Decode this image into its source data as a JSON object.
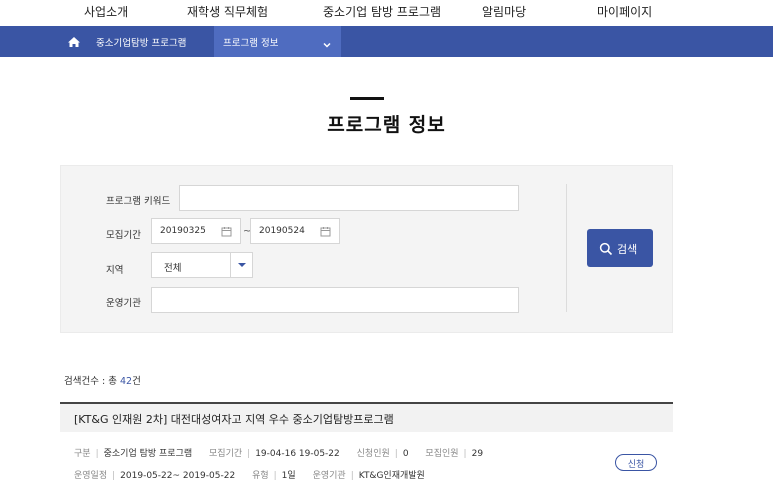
{
  "top_nav": {
    "items": [
      "사업소개",
      "재학생 직무체험",
      "중소기업 탐방 프로그램",
      "알림마당",
      "마이페이지"
    ]
  },
  "breadcrumb": {
    "home_icon": "home-icon",
    "section": "중소기업탐방 프로그램",
    "current": "프로그램 정보",
    "current_icon": "chevron-down-icon"
  },
  "page": {
    "title": "프로그램 정보"
  },
  "search": {
    "keyword_label": "프로그램 키워드",
    "keyword_value": "",
    "period_label": "모집기간",
    "date_from": "20190325",
    "date_tilde": "~",
    "date_to": "20190524",
    "region_label": "지역",
    "region_value": "전체",
    "org_label": "운영기관",
    "org_value": "",
    "button_label": "검색"
  },
  "results": {
    "count_prefix": "검색건수 : 총",
    "count_value": "42",
    "count_suffix": "건",
    "items": [
      {
        "title": "[KT&G 인재원 2차] 대전대성여자고 지역 우수 중소기업탐방프로그램",
        "type_label": "구분",
        "type_value": "중소기업 탐방 프로그램",
        "recruit_label": "모집기간",
        "recruit_value": "19-04-16 19-05-22",
        "applicants_label": "신청인원",
        "applicants_value": "0",
        "capacity_label": "모집인원",
        "capacity_value": "29",
        "schedule_label": "운영일정",
        "schedule_value": "2019-05-22~ 2019-05-22",
        "kind_label": "유형",
        "kind_value": "1일",
        "org_label": "운영기관",
        "org_value": "KT&G인재개발원",
        "apply_label": "신청"
      }
    ]
  },
  "colors": {
    "brand": "#3a55a4",
    "brand_light": "#4f6cc0"
  }
}
